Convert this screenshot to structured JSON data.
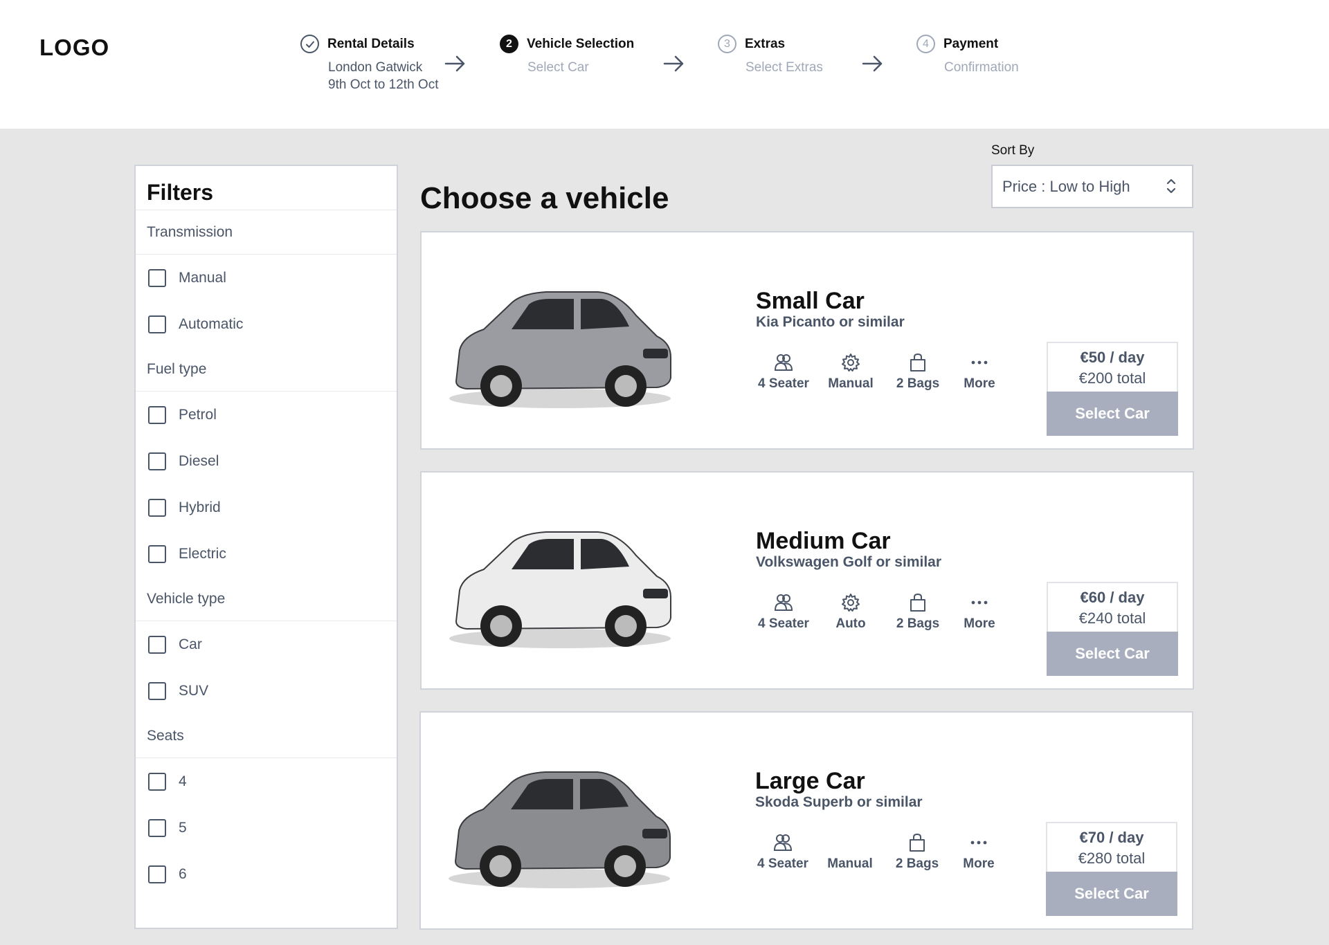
{
  "header": {
    "logo": "LOGO",
    "steps": [
      {
        "number": "",
        "title": "Rental Details",
        "sub1": "London Gatwick",
        "sub2": "9th Oct to 12th Oct",
        "state": "done"
      },
      {
        "number": "2",
        "title": "Vehicle Selection",
        "sub1": "Select Car",
        "state": "active"
      },
      {
        "number": "3",
        "title": "Extras",
        "sub1": "Select Extras",
        "state": "todo"
      },
      {
        "number": "4",
        "title": "Payment",
        "sub1": "Confirmation",
        "state": "todo"
      }
    ]
  },
  "filters": {
    "title": "Filters",
    "groups": [
      {
        "title": "Transmission",
        "options": [
          "Manual",
          "Automatic"
        ]
      },
      {
        "title": "Fuel type",
        "options": [
          "Petrol",
          "Diesel",
          "Hybrid",
          "Electric"
        ]
      },
      {
        "title": "Vehicle type",
        "options": [
          "Car",
          "SUV"
        ]
      },
      {
        "title": "Seats",
        "options": [
          "4",
          "5",
          "6"
        ]
      }
    ]
  },
  "main": {
    "title": "Choose a vehicle",
    "sort_label": "Sort By",
    "sort_value": "Price : Low to High"
  },
  "vehicles": [
    {
      "name": "Small Car",
      "model": "Kia Picanto or similar",
      "seats": "4 Seater",
      "transmission": "Manual",
      "bags": "2 Bags",
      "more": "More",
      "price_day": "€50 / day",
      "price_total": "€200 total",
      "button": "Select Car",
      "color": "#9a9ca2"
    },
    {
      "name": "Medium Car",
      "model": "Volkswagen Golf or similar",
      "seats": "4 Seater",
      "transmission": "Auto",
      "bags": "2 Bags",
      "more": "More",
      "price_day": "€60 / day",
      "price_total": "€240 total",
      "button": "Select Car",
      "color": "#ececec"
    },
    {
      "name": "Large Car",
      "model": "Skoda Superb or similar",
      "seats": "4 Seater",
      "transmission": "Manual",
      "bags": "2 Bags",
      "more": "More",
      "price_day": "€70 / day",
      "price_total": "€280 total",
      "button": "Select Car",
      "color": "#8b8c8f"
    }
  ],
  "colors": {
    "accent_text": "#4a5568",
    "muted_text": "#a0a8b8",
    "button_bg": "#a8aebd",
    "page_bg": "#e6e6e6"
  }
}
